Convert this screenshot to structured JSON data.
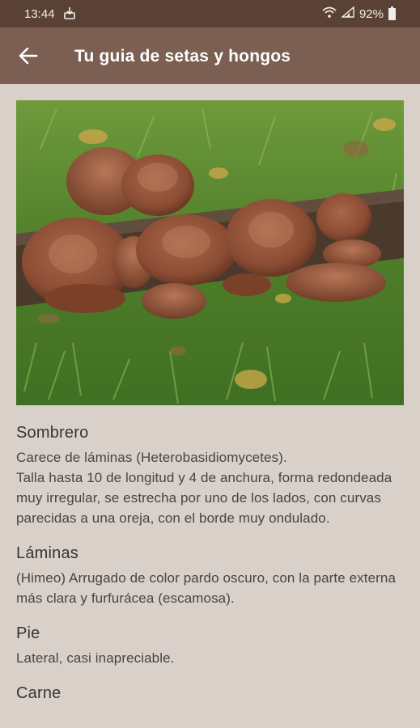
{
  "status_bar": {
    "time": "13:44",
    "battery": "92%",
    "notification_icon": "download-icon",
    "wifi_icon": "wifi-icon",
    "signal_icon": "signal-icon"
  },
  "app_bar": {
    "title": "Tu guia de setas y hongos",
    "back_icon": "arrow-back-icon",
    "color": "#7b5f53"
  },
  "photo": {
    "subject": "mushroom photo"
  },
  "sections": [
    {
      "heading": "Sombrero",
      "body": "Carece de láminas (Heterobasidiomycetes).\nTalla hasta 10 de longitud y 4 de anchura, forma redondeada muy irregular, se estrecha por uno de los lados, con curvas parecidas a una oreja, con el borde muy ondulado."
    },
    {
      "heading": "Láminas",
      "body": "(Himeo) Arrugado de color pardo oscuro, con la parte externa más clara y furfurácea (escamosa)."
    },
    {
      "heading": "Pie",
      "body": "Lateral, casi inapreciable."
    },
    {
      "heading": "Carne",
      "body": ""
    }
  ]
}
